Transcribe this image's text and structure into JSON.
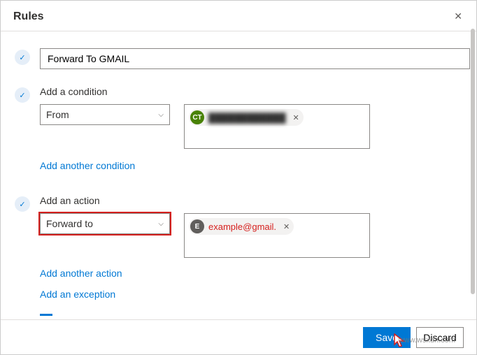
{
  "header": {
    "title": "Rules"
  },
  "rule_name": {
    "value": "Forward To GMAIL"
  },
  "condition": {
    "title": "Add a condition",
    "selector": "From",
    "contact": {
      "initials": "CT",
      "name_redacted": "████████████"
    },
    "add_link": "Add another condition"
  },
  "action": {
    "title": "Add an action",
    "selector": "Forward to",
    "contact": {
      "initials": "E",
      "email": "example@gmail."
    },
    "add_action_link": "Add another action",
    "add_exception_link": "Add an exception"
  },
  "footer": {
    "save": "Save",
    "discard": "Discard"
  },
  "watermark": "www.wsxdn.com"
}
